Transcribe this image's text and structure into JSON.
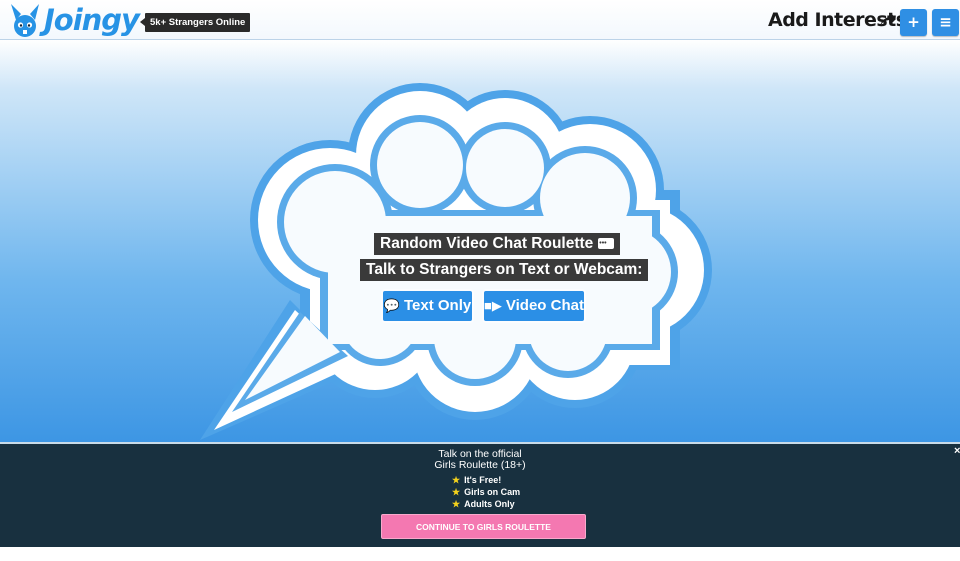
{
  "header": {
    "logo_text": "Joingy",
    "online_badge": "5k+ Strangers Online",
    "add_interests": "Add Interests",
    "plus_label": "+",
    "menu_label": "≡"
  },
  "main": {
    "headline": "Random Video Chat Roulette",
    "subheadline": "Talk to Strangers on Text or Webcam:",
    "text_button": "Text Only",
    "video_button": "Video Chat"
  },
  "promo": {
    "line1": "Talk on the official",
    "line2": "Girls Roulette (18+)",
    "features": [
      "It's Free!",
      "Girls on Cam",
      "Adults Only"
    ],
    "cta": "CONTINUE TO GIRLS ROULETTE",
    "close": "×"
  },
  "colors": {
    "accent": "#2b8fe6",
    "promo_bg": "#18303f",
    "cta_pink": "#f478b1",
    "star": "#f4d21c"
  }
}
